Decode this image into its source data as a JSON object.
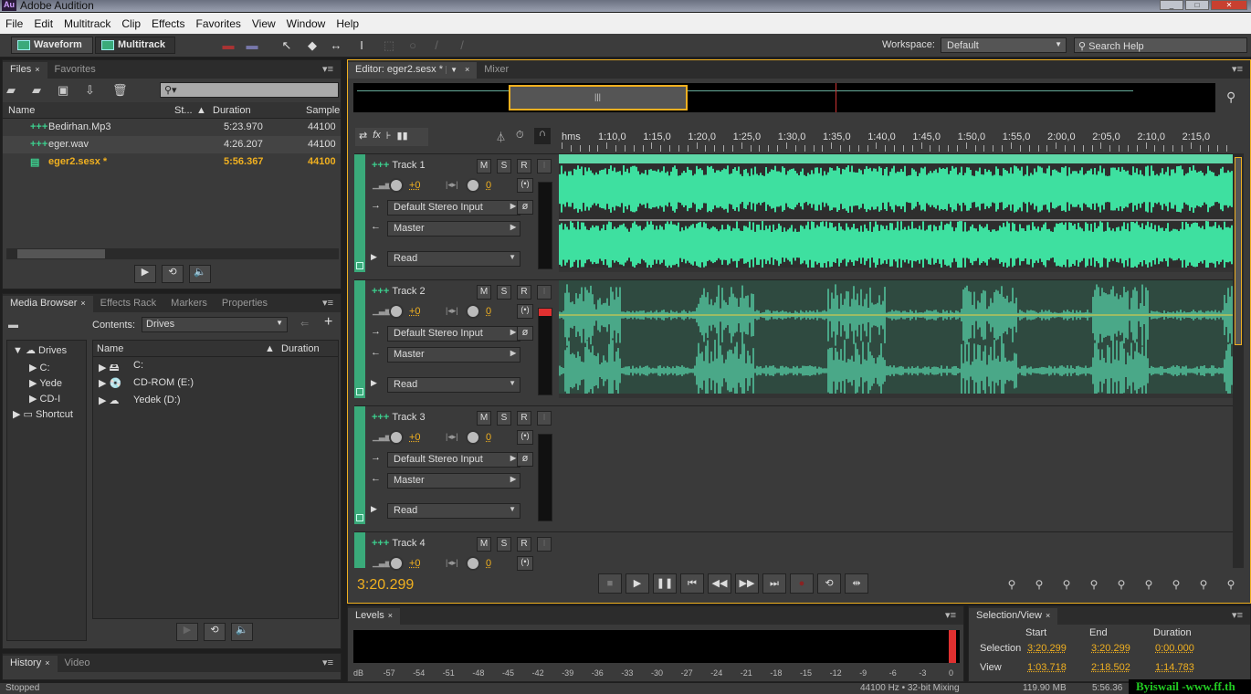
{
  "app": {
    "title": "Adobe Audition",
    "logo": "Au"
  },
  "menu": [
    "File",
    "Edit",
    "Multitrack",
    "Clip",
    "Effects",
    "Favorites",
    "View",
    "Window",
    "Help"
  ],
  "toolbar": {
    "waveform": "Waveform",
    "multitrack": "Multitrack",
    "workspace_label": "Workspace:",
    "workspace_value": "Default",
    "search_placeholder": "Search Help"
  },
  "files": {
    "tabs": [
      "Files",
      "Favorites"
    ],
    "columns": [
      "Name",
      "St...",
      "Duration",
      "Sample"
    ],
    "rows": [
      {
        "name": "Bedirhan.Mp3",
        "duration": "5:23.970",
        "sample": "44100"
      },
      {
        "name": "eger.wav",
        "duration": "4:26.207",
        "sample": "44100"
      },
      {
        "name": "eger2.sesx *",
        "duration": "5:56.367",
        "sample": "44100"
      }
    ]
  },
  "media": {
    "tabs": [
      "Media Browser",
      "Effects Rack",
      "Markers",
      "Properties"
    ],
    "contents_label": "Contents:",
    "contents_value": "Drives",
    "tree": [
      "Drives",
      "C:",
      "Yede",
      "CD-I",
      "Shortcut"
    ],
    "columns": [
      "Name",
      "Duration"
    ],
    "items": [
      "C:",
      "CD-ROM (E:)",
      "Yedek (D:)"
    ]
  },
  "history": {
    "tabs": [
      "History",
      "Video"
    ]
  },
  "editor": {
    "tab": "Editor: eger2.sesx *",
    "mixer": "Mixer",
    "ruler_unit": "hms",
    "ruler": [
      "1:10,0",
      "1:15,0",
      "1:20,0",
      "1:25,0",
      "1:30,0",
      "1:35,0",
      "1:40,0",
      "1:45,0",
      "1:50,0",
      "1:55,0",
      "2:00,0",
      "2:05,0",
      "2:10,0",
      "2:15,0"
    ],
    "tracks": [
      {
        "name": "Track 1",
        "volume": "+0",
        "pan": "0",
        "input": "Default Stereo Input",
        "output": "Master",
        "automation": "Read"
      },
      {
        "name": "Track 2",
        "volume": "+0",
        "pan": "0",
        "input": "Default Stereo Input",
        "output": "Master",
        "automation": "Read"
      },
      {
        "name": "Track 3",
        "volume": "+0",
        "pan": "0",
        "input": "Default Stereo Input",
        "output": "Master",
        "automation": "Read"
      },
      {
        "name": "Track 4",
        "volume": "+0",
        "pan": "0"
      }
    ],
    "btn_m": "M",
    "btn_s": "S",
    "btn_r": "R",
    "btn_i": "I",
    "time": "3:20.299"
  },
  "levels": {
    "tab": "Levels",
    "scale": [
      "dB",
      "-57",
      "-54",
      "-51",
      "-48",
      "-45",
      "-42",
      "-39",
      "-36",
      "-33",
      "-30",
      "-27",
      "-24",
      "-21",
      "-18",
      "-15",
      "-12",
      "-9",
      "-6",
      "-3",
      "0"
    ]
  },
  "selection_view": {
    "tab": "Selection/View",
    "headers": [
      "Start",
      "End",
      "Duration"
    ],
    "selection": {
      "label": "Selection",
      "start": "3:20.299",
      "end": "3:20.299",
      "duration": "0:00.000"
    },
    "view": {
      "label": "View",
      "start": "1:03.718",
      "end": "2:18.502",
      "duration": "1:14.783"
    }
  },
  "status": {
    "state": "Stopped",
    "format": "44100 Hz • 32-bit Mixing",
    "memory": "119.90 MB",
    "duration": "5:56.36",
    "watermark": "Byiswail -www.ff.th"
  },
  "colors": {
    "accent": "#f0b020",
    "waveform": "#3ee0a0",
    "track_bar": "#3aaa7a"
  }
}
